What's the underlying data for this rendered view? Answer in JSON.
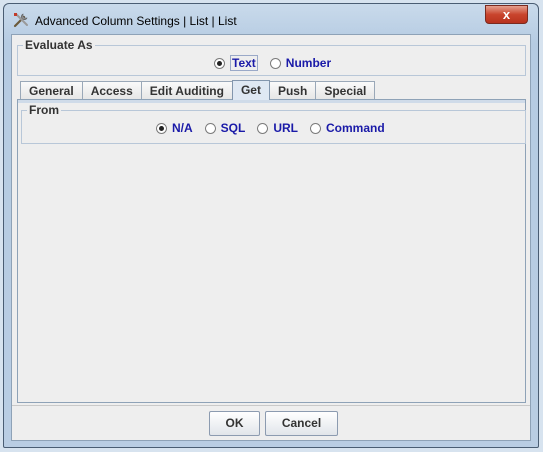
{
  "window": {
    "title": "Advanced Column Settings | List | List",
    "close_label": "x"
  },
  "evaluate_as": {
    "title": "Evaluate As",
    "options": [
      {
        "label": "Text",
        "selected": true
      },
      {
        "label": "Number",
        "selected": false
      }
    ]
  },
  "tabs": [
    {
      "label": "General",
      "active": false
    },
    {
      "label": "Access",
      "active": false
    },
    {
      "label": "Edit Auditing",
      "active": false
    },
    {
      "label": "Get",
      "active": true
    },
    {
      "label": "Push",
      "active": false
    },
    {
      "label": "Special",
      "active": false
    }
  ],
  "from": {
    "title": "From",
    "options": [
      {
        "label": "N/A",
        "selected": true
      },
      {
        "label": "SQL",
        "selected": false
      },
      {
        "label": "URL",
        "selected": false
      },
      {
        "label": "Command",
        "selected": false
      }
    ]
  },
  "buttons": {
    "ok": "OK",
    "cancel": "Cancel"
  }
}
